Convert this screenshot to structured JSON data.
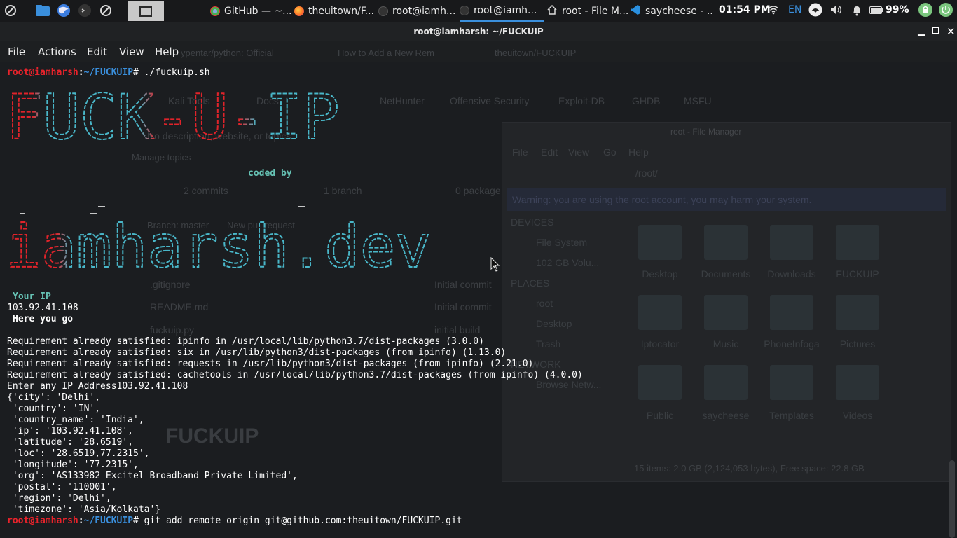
{
  "panel": {
    "tasks": [
      {
        "label": "GitHub — ~...",
        "icon": "chrome-icon"
      },
      {
        "label": "theuitown/F...",
        "icon": "firefox-icon"
      },
      {
        "label": "root@iamh...",
        "icon": "terminal-icon"
      },
      {
        "label": "root@iamh...",
        "icon": "terminal-icon",
        "active": true
      },
      {
        "label": "root - File M...",
        "icon": "home-folder-icon"
      },
      {
        "label": "saycheese - ...",
        "icon": "vscode-icon"
      }
    ],
    "clock": "01:54 PM",
    "keyboard_layout": "EN",
    "battery": "99%"
  },
  "window": {
    "title": "root@iamharsh: ~/FUCKUIP"
  },
  "menu": [
    "File",
    "Actions",
    "Edit",
    "View",
    "Help"
  ],
  "terminal": {
    "prompt_user": "root@iamharsh",
    "prompt_path": "~/FUCKUIP",
    "cmd1": "# ./fuckuip.sh",
    "banner_title": "FUCK-U-IP",
    "coded_by": "coded by",
    "banner_author": "iamharsh.dev",
    "your_ip_label": "Your IP",
    "ip": "103.92.41.108",
    "here_you_go": "Here you go",
    "lines": [
      "Requirement already satisfied: ipinfo in /usr/local/lib/python3.7/dist-packages (3.0.0)",
      "Requirement already satisfied: six in /usr/lib/python3/dist-packages (from ipinfo) (1.13.0)",
      "Requirement already satisfied: requests in /usr/lib/python3/dist-packages (from ipinfo) (2.21.0)",
      "Requirement already satisfied: cachetools in /usr/local/lib/python3.7/dist-packages (from ipinfo) (4.0.0)",
      "Enter any IP Address103.92.41.108",
      "{'city': 'Delhi',",
      " 'country': 'IN',",
      " 'country_name': 'India',",
      " 'ip': '103.92.41.108',",
      " 'latitude': '28.6519',",
      " 'loc': '28.6519,77.2315',",
      " 'longitude': '77.2315',",
      " 'org': 'AS133982 Excitel Broadband Private Limited',",
      " 'postal': '110001',",
      " 'region': 'Delhi',",
      " 'timezone': 'Asia/Kolkata'}"
    ],
    "cmd2": "# git add remote origin git@github.com:theuitown/FUCKUIP.git"
  },
  "background": {
    "browser_tabs": [
      "ypentar/python: Official",
      "How to Add a New Rem",
      "theuitown/FUCKUIP"
    ],
    "bookmarks": [
      "Kali Tools",
      "Docs",
      "NetHunter",
      "Offensive Security",
      "Exploit-DB",
      "GHDB",
      "MSFU"
    ],
    "repo_description": "No description, website, or topics",
    "manage_topics": "Manage topics",
    "commits": "2 commits",
    "branch": "1 branch",
    "packages": "0 package",
    "branch_btn": "Branch: master",
    "new_pr": "New pull request",
    "files": [
      ".gitignore",
      "README.md",
      "fuckuip.py"
    ],
    "commit_msgs": [
      "Initial commit",
      "Initial commit",
      "initial build"
    ],
    "readme_heading": "FUCKUIP",
    "file_manager": {
      "title": "root - File Manager",
      "menu": [
        "File",
        "Edit",
        "View",
        "Go",
        "Help"
      ],
      "path": "/root/",
      "warning": "Warning: you are using the root account, you may harm your system.",
      "devices_header": "DEVICES",
      "devices": [
        "File System",
        "102 GB Volu..."
      ],
      "places_header": "PLACES",
      "places": [
        "root",
        "Desktop",
        "Trash"
      ],
      "network_header": "NETWORK",
      "network": [
        "Browse Netw..."
      ],
      "folders": [
        "Desktop",
        "Documents",
        "Downloads",
        "FUCKUIP",
        "Iptocator",
        "Music",
        "PhoneInfoga",
        "Pictures",
        "Public",
        "saycheese",
        "Templates",
        "Videos"
      ],
      "status": "15 items: 2.0 GB (2,124,053 bytes), Free space: 22.8 GB"
    }
  }
}
